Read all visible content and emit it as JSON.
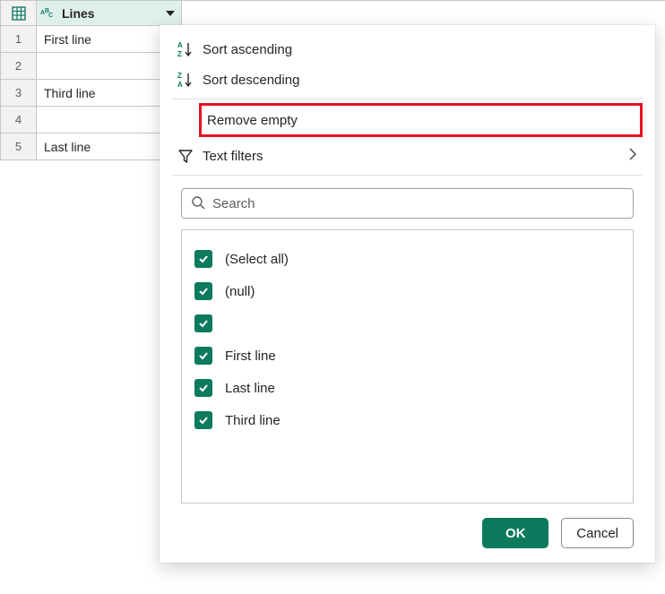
{
  "column": {
    "name": "Lines",
    "type_label": "ABC"
  },
  "rows": [
    {
      "num": "1",
      "value": "First line"
    },
    {
      "num": "2",
      "value": ""
    },
    {
      "num": "3",
      "value": "Third line"
    },
    {
      "num": "4",
      "value": ""
    },
    {
      "num": "5",
      "value": "Last line"
    }
  ],
  "menu": {
    "sort_asc": "Sort ascending",
    "sort_desc": "Sort descending",
    "remove_empty": "Remove empty",
    "text_filters": "Text filters"
  },
  "search": {
    "placeholder": "Search"
  },
  "filter_values": {
    "select_all": "(Select all)",
    "null": "(null)",
    "blank": "",
    "v1": "First line",
    "v2": "Last line",
    "v3": "Third line"
  },
  "buttons": {
    "ok": "OK",
    "cancel": "Cancel"
  }
}
